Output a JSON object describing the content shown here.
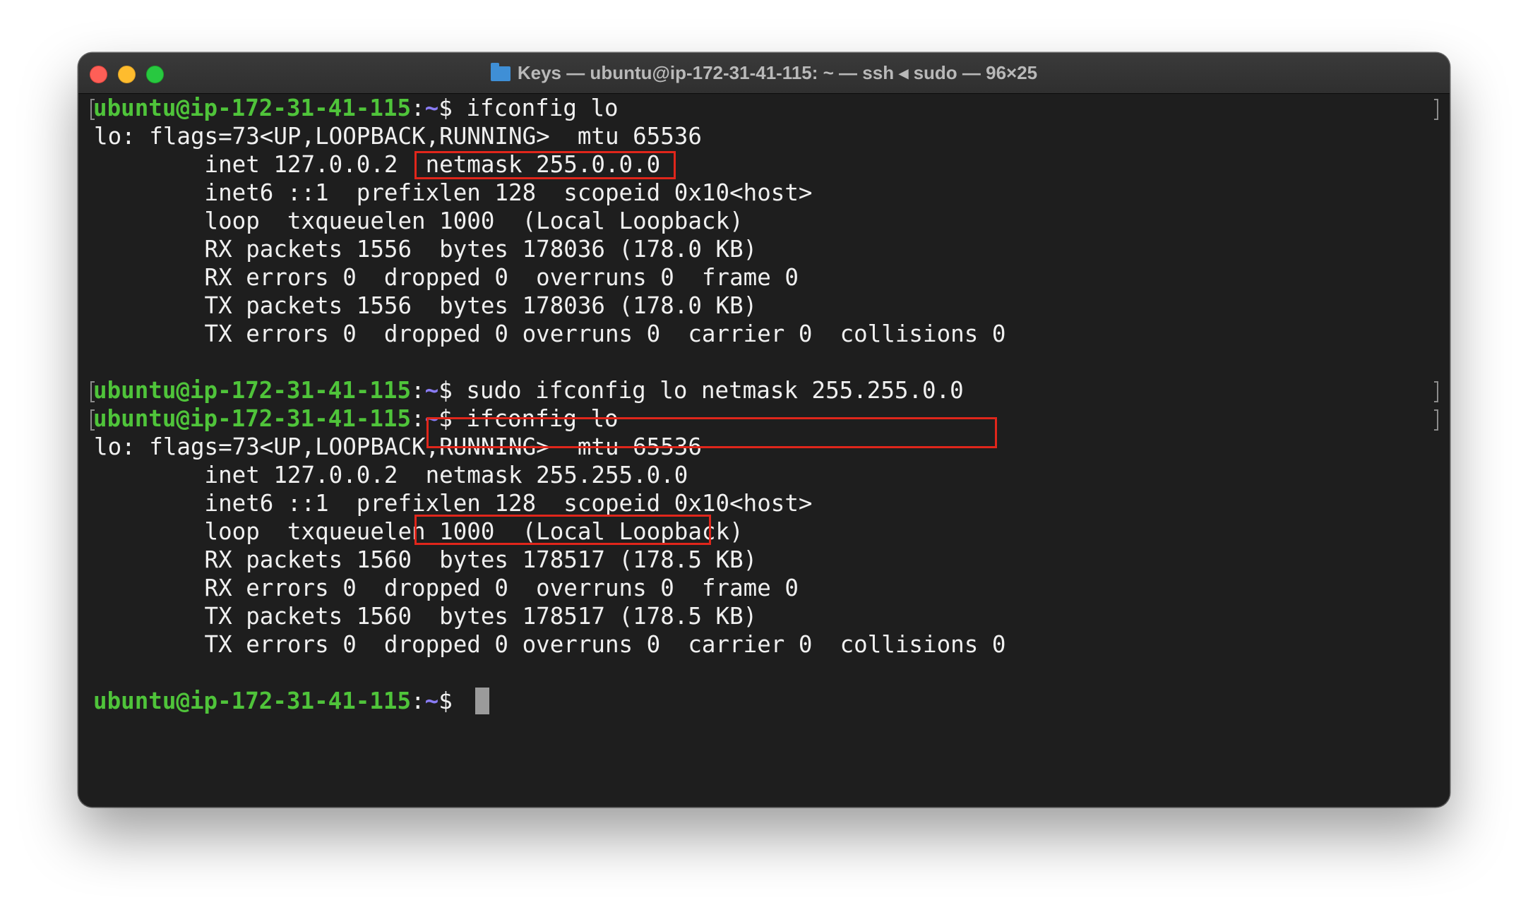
{
  "window": {
    "title": "Keys — ubuntu@ip-172-31-41-115: ~ — ssh ◂ sudo — 96×25"
  },
  "prompt": {
    "user": "ubuntu@ip-172-31-41-115",
    "colon": ":",
    "path": "~",
    "symbol": "$"
  },
  "commands": {
    "first": " ifconfig lo",
    "second": " sudo ifconfig lo netmask 255.255.0.0",
    "third": " ifconfig lo"
  },
  "output1": [
    "lo: flags=73<UP,LOOPBACK,RUNNING>  mtu 65536",
    "        inet 127.0.0.2  netmask 255.0.0.0",
    "        inet6 ::1  prefixlen 128  scopeid 0x10<host>",
    "        loop  txqueuelen 1000  (Local Loopback)",
    "        RX packets 1556  bytes 178036 (178.0 KB)",
    "        RX errors 0  dropped 0  overruns 0  frame 0",
    "        TX packets 1556  bytes 178036 (178.0 KB)",
    "        TX errors 0  dropped 0 overruns 0  carrier 0  collisions 0"
  ],
  "output2": [
    "lo: flags=73<UP,LOOPBACK,RUNNING>  mtu 65536",
    "        inet 127.0.0.2  netmask 255.255.0.0",
    "        inet6 ::1  prefixlen 128  scopeid 0x10<host>",
    "        loop  txqueuelen 1000  (Local Loopback)",
    "        RX packets 1560  bytes 178517 (178.5 KB)",
    "        RX errors 0  dropped 0  overruns 0  frame 0",
    "        TX packets 1560  bytes 178517 (178.5 KB)",
    "        TX errors 0  dropped 0 overruns 0  carrier 0  collisions 0"
  ],
  "colors": {
    "prompt_user": "#4fc43a",
    "prompt_path": "#8a7cf5",
    "highlight": "#e0261b",
    "background": "#1e1e1e"
  }
}
